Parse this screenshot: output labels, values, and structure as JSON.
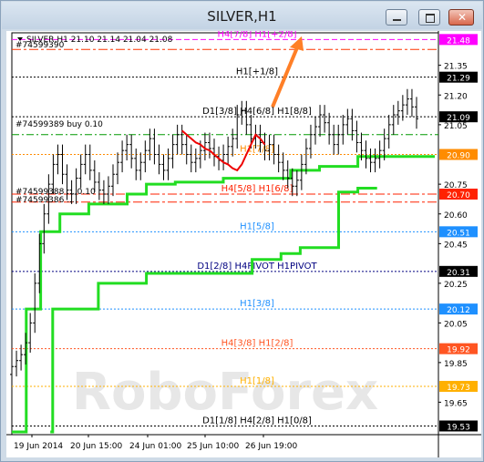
{
  "window": {
    "title": "SILVER,H1"
  },
  "chart_data": {
    "type": "candlestick",
    "symbol_header": "SILVER,H1  21.10 21.14 21.04 21.08",
    "ohlc": {
      "open": 21.1,
      "high": 21.14,
      "low": 21.04,
      "close": 21.08
    },
    "ylim": [
      19.5,
      21.5
    ],
    "y_ticks": [
      21.35,
      21.2,
      21.05,
      20.75,
      20.6,
      20.45,
      20.25,
      20.05,
      19.85,
      19.65
    ],
    "x_ticks": [
      "19 Jun 2014",
      "20 Jun 15:00",
      "24 Jun 01:00",
      "25 Jun 10:00",
      "26 Jun 19:00"
    ],
    "price_tags": [
      {
        "value": 21.48,
        "label": "21.48",
        "color": "#ff00ff"
      },
      {
        "value": 21.29,
        "label": "21.29",
        "color": "#000000"
      },
      {
        "value": 21.09,
        "label": "21.09",
        "color": "#000000"
      },
      {
        "value": 20.9,
        "label": "20.90",
        "color": "#ff8c00"
      },
      {
        "value": 20.7,
        "label": "20.70",
        "color": "#ff2200"
      },
      {
        "value": 20.51,
        "label": "20.51",
        "color": "#1e90ff"
      },
      {
        "value": 20.31,
        "label": "20.31",
        "color": "#000000"
      },
      {
        "value": 20.12,
        "label": "20.12",
        "color": "#1e90ff"
      },
      {
        "value": 19.92,
        "label": "19.92",
        "color": "#ff5522"
      },
      {
        "value": 19.73,
        "label": "19.73",
        "color": "#ffb000"
      },
      {
        "value": 19.53,
        "label": "19.53",
        "color": "#000000"
      }
    ],
    "levels": [
      {
        "value": 21.48,
        "label": "H4[7/8] H1[+2/8]",
        "color": "#ff00ff",
        "dash": "6,3",
        "label_color": "#ff00ff"
      },
      {
        "value": 21.43,
        "label": "",
        "color": "#ff3300",
        "dash": "10,3,3,3",
        "label_color": "#ff3300"
      },
      {
        "value": 21.29,
        "label": "H1[+1/8]",
        "color": "#000000",
        "dash": "2,2",
        "label_color": "#000000"
      },
      {
        "value": 21.09,
        "label": "D1[3/8] H4[6/8] H1[8/8]",
        "color": "#000000",
        "dash": "2,2",
        "label_color": "#000000"
      },
      {
        "value": 21.0,
        "label": "",
        "color": "#009900",
        "dash": "8,3,2,3",
        "label_color": "#009900"
      },
      {
        "value": 20.9,
        "label": "H1[7/8]",
        "color": "#ff8c00",
        "dash": "2,2",
        "label_color": "#ff8c00"
      },
      {
        "value": 20.7,
        "label": "H4[5/8] H1[6/8]",
        "color": "#ff2200",
        "dash": "10,3,3,3",
        "label_color": "#ff2200"
      },
      {
        "value": 20.66,
        "label": "",
        "color": "#ff2200",
        "dash": "10,3,3,3",
        "label_color": "#ff2200"
      },
      {
        "value": 20.51,
        "label": "H1[5/8]",
        "color": "#1e90ff",
        "dash": "2,2",
        "label_color": "#1e90ff"
      },
      {
        "value": 20.31,
        "label": "D1[2/8] H4PIVOT H1PIVOT",
        "color": "#000080",
        "dash": "2,2",
        "label_color": "#000080"
      },
      {
        "value": 20.12,
        "label": "H1[3/8]",
        "color": "#1e90ff",
        "dash": "2,2",
        "label_color": "#1e90ff"
      },
      {
        "value": 19.92,
        "label": "H4[3/8] H1[2/8]",
        "color": "#ff5522",
        "dash": "2,2",
        "label_color": "#ff5522"
      },
      {
        "value": 19.73,
        "label": "H1[1/8]",
        "color": "#ffb000",
        "dash": "2,2",
        "label_color": "#ffb000"
      },
      {
        "value": 19.53,
        "label": "D1[1/8] H4[2/8] H1[0/8]",
        "color": "#000000",
        "dash": "2,2",
        "label_color": "#000000"
      }
    ],
    "orders": [
      {
        "value": 21.43,
        "label": "#74599390"
      },
      {
        "value": 21.03,
        "label": "#74599389 buy 0.10"
      },
      {
        "value": 20.69,
        "label": "#74599388 ... 0.10"
      },
      {
        "value": 20.65,
        "label": "#74599386 ..."
      }
    ],
    "closes": [
      19.83,
      19.86,
      19.89,
      19.95,
      20.05,
      20.25,
      20.45,
      20.6,
      20.75,
      20.85,
      20.9,
      20.8,
      20.72,
      20.7,
      20.78,
      20.85,
      20.9,
      20.82,
      20.76,
      20.72,
      20.7,
      20.74,
      20.8,
      20.86,
      20.92,
      20.95,
      20.88,
      20.82,
      20.86,
      20.92,
      20.98,
      20.9,
      20.85,
      20.82,
      20.88,
      20.95,
      21.0,
      20.95,
      20.9,
      20.86,
      20.88,
      20.92,
      20.96,
      20.93,
      20.89,
      20.87,
      20.9,
      20.94,
      20.98,
      21.1,
      21.12,
      21.05,
      20.98,
      21.0,
      20.96,
      20.92,
      20.95,
      20.9,
      20.86,
      20.82,
      20.78,
      20.74,
      20.77,
      20.85,
      20.93,
      21.0,
      21.04,
      21.1,
      21.06,
      21.0,
      20.95,
      21.0,
      21.05,
      21.08,
      21.02,
      20.96,
      20.92,
      20.88,
      20.86,
      20.88,
      20.92,
      20.98,
      21.05,
      21.1,
      21.12,
      21.15,
      21.18,
      21.14,
      21.08
    ],
    "red_segment": {
      "from": 37,
      "to": 56,
      "values": [
        21.02,
        21.0,
        20.98,
        20.96,
        20.95,
        20.93,
        20.92,
        20.9,
        20.88,
        20.86,
        20.85,
        20.83,
        20.82,
        20.85,
        20.9,
        20.95,
        21.0,
        20.98,
        20.95
      ]
    },
    "support_steps": [
      {
        "x0": 0,
        "x1": 3,
        "y": 19.5
      },
      {
        "x0": 3,
        "x1": 6,
        "y": 20.12
      },
      {
        "x0": 6,
        "x1": 10,
        "y": 20.51
      },
      {
        "x0": 10,
        "x1": 16,
        "y": 20.6
      },
      {
        "x0": 16,
        "x1": 24,
        "y": 20.65
      },
      {
        "x0": 24,
        "x1": 28,
        "y": 20.7
      },
      {
        "x0": 28,
        "x1": 34,
        "y": 20.75
      },
      {
        "x0": 34,
        "x1": 44,
        "y": 20.76
      },
      {
        "x0": 44,
        "x1": 58,
        "y": 20.78
      },
      {
        "x0": 58,
        "x1": 64,
        "y": 20.82
      },
      {
        "x0": 64,
        "x1": 72,
        "y": 20.84
      },
      {
        "x0": 72,
        "x1": 88,
        "y": 20.89
      }
    ],
    "support2_steps": [
      {
        "x0": 8,
        "x1": 8.5,
        "y": 19.5
      },
      {
        "x0": 8.5,
        "x1": 18,
        "y": 20.12
      },
      {
        "x0": 18,
        "x1": 28,
        "y": 20.25
      },
      {
        "x0": 28,
        "x1": 50,
        "y": 20.3
      },
      {
        "x0": 50,
        "x1": 56,
        "y": 20.37
      },
      {
        "x0": 56,
        "x1": 60,
        "y": 20.4
      },
      {
        "x0": 60,
        "x1": 64,
        "y": 20.43
      },
      {
        "x0": 64,
        "x1": 68,
        "y": 20.43
      },
      {
        "x0": 68,
        "x1": 72,
        "y": 20.71
      },
      {
        "x0": 72,
        "x1": 76,
        "y": 20.73
      }
    ],
    "watermark": "RoboForex"
  }
}
